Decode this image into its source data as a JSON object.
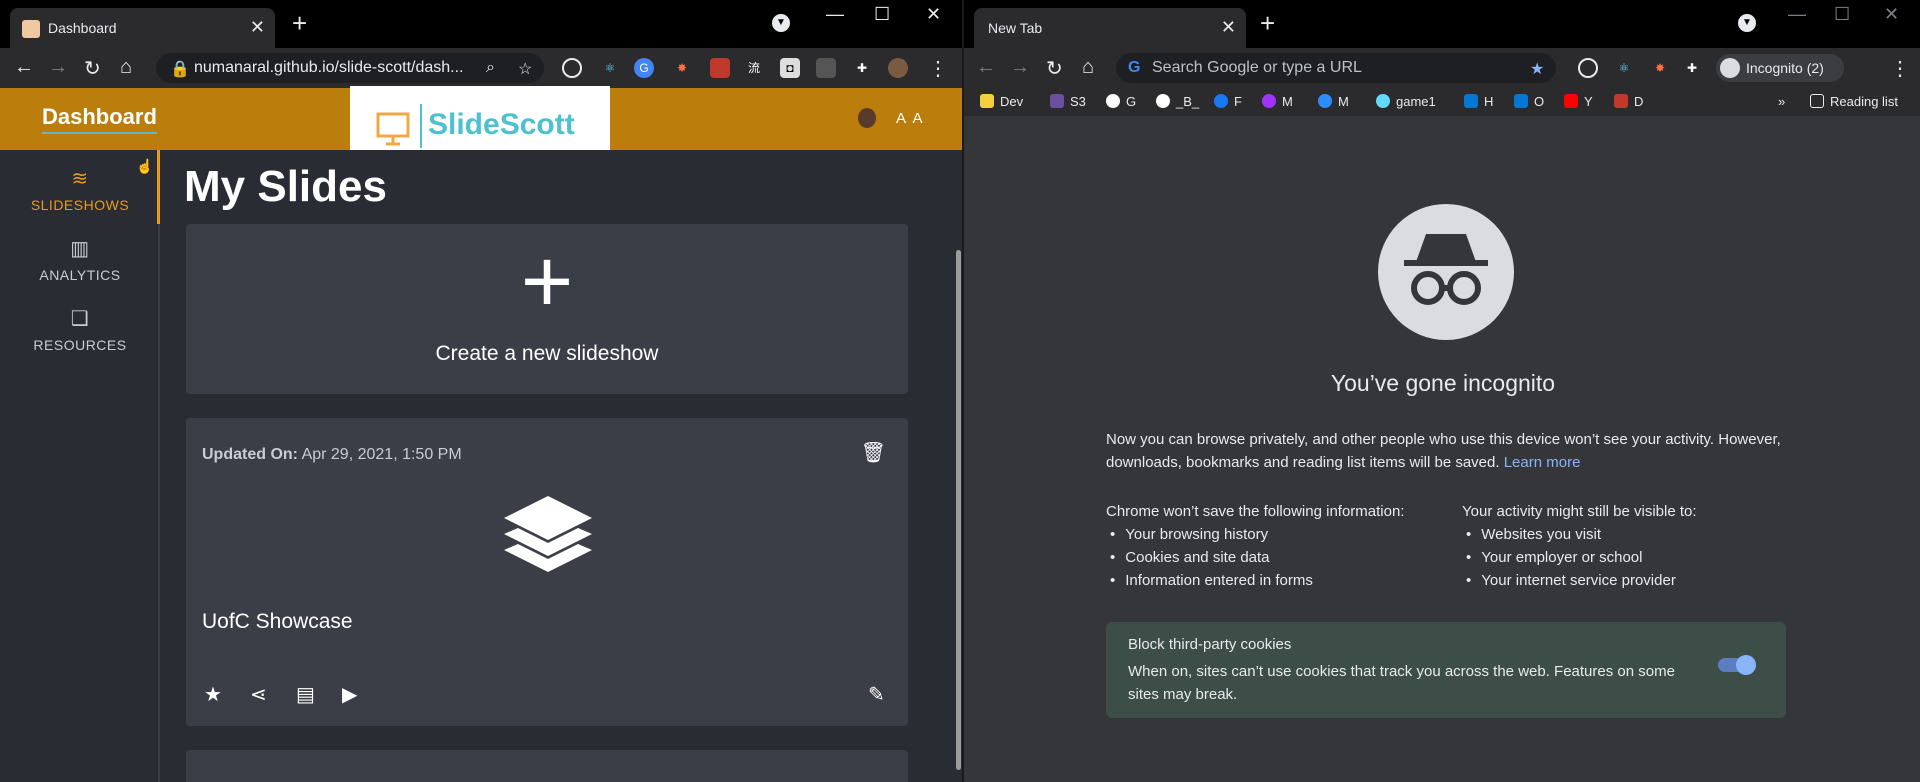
{
  "left_window": {
    "tab": {
      "title": "Dashboard"
    },
    "url": "numanaral.github.io/slide-scott/dash...",
    "app": {
      "header_title": "Dashboard",
      "brand_name": "SlideScott",
      "user_initials": "A A",
      "sidebar": [
        {
          "label": "SLIDESHOWS",
          "icon": "layers-icon",
          "active": true
        },
        {
          "label": "ANALYTICS",
          "icon": "bar-chart-icon",
          "active": false
        },
        {
          "label": "RESOURCES",
          "icon": "bookmarks-icon",
          "active": false
        }
      ],
      "page_title": "My Slides",
      "create_label": "Create a new slideshow",
      "slideshow": {
        "updated_label": "Updated On:",
        "updated_value": "Apr 29, 2021, 1:50 PM",
        "name": "UofC Showcase"
      }
    },
    "accent_color": "#bb7d0c"
  },
  "right_window": {
    "tab": {
      "title": "New Tab"
    },
    "omnibox_placeholder": "Search Google or type a URL",
    "profile_label": "Incognito (2)",
    "bookmarks": [
      {
        "label": "Dev",
        "color": "#f4d03f"
      },
      {
        "label": "S3",
        "color": "#6c4fa0"
      },
      {
        "label": "G",
        "color": "#ffffff"
      },
      {
        "label": "_B_",
        "color": "#ffffff"
      },
      {
        "label": "F",
        "color": "#1877f2"
      },
      {
        "label": "M",
        "color": "#a033ff"
      },
      {
        "label": "M",
        "color": "#2d8cff"
      },
      {
        "label": "game1",
        "color": "#61dafb"
      },
      {
        "label": "H",
        "color": "#0078d4"
      },
      {
        "label": "O",
        "color": "#0078d4"
      },
      {
        "label": "Y",
        "color": "#ff0000"
      },
      {
        "label": "D",
        "color": "#c0392b"
      }
    ],
    "reading_list": "Reading list",
    "incognito": {
      "title": "You’ve gone incognito",
      "description": "Now you can browse privately, and other people who use this device won’t see your activity. However, downloads, bookmarks and reading list items will be saved.",
      "learn_more": "Learn more",
      "not_saved_heading": "Chrome won’t save the following information:",
      "not_saved": [
        "Your browsing history",
        "Cookies and site data",
        "Information entered in forms"
      ],
      "visible_heading": "Your activity might still be visible to:",
      "visible": [
        "Websites you visit",
        "Your employer or school",
        "Your internet service provider"
      ],
      "cookies_title": "Block third-party cookies",
      "cookies_desc": "When on, sites can’t use cookies that track you across the web. Features on some sites may break.",
      "cookies_toggle_on": true
    }
  }
}
